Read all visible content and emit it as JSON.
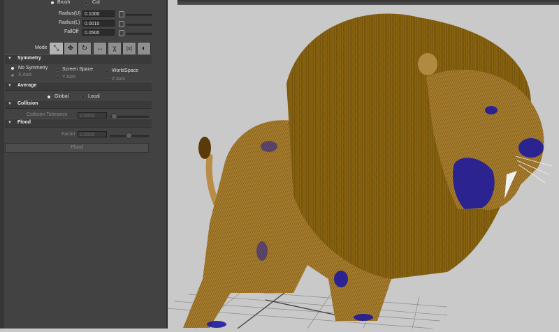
{
  "brush_options": {
    "brush": "Brush",
    "cut": "Cut"
  },
  "fields": [
    {
      "label": "Radius(U)",
      "value": "0.1000"
    },
    {
      "label": "Radius(L)",
      "value": "0.0010"
    },
    {
      "label": "FallOff",
      "value": "0.0500"
    }
  ],
  "mode": {
    "label": "Mode",
    "buttons": [
      {
        "icon": "comb-icon",
        "glyph": "⤡"
      },
      {
        "icon": "move-icon",
        "glyph": "✥"
      },
      {
        "icon": "rotate-icon",
        "glyph": "↻"
      },
      {
        "icon": "scale-icon",
        "glyph": "↔"
      },
      {
        "icon": "curl-icon",
        "glyph": "χ"
      },
      {
        "icon": "length-icon",
        "glyph": "|x|"
      },
      {
        "icon": "smooth-icon",
        "glyph": "◐"
      }
    ]
  },
  "symmetry": {
    "title": "Symmetry",
    "none": "No Symmetry",
    "screen": "Screen Space",
    "world": "WorldSpace",
    "x": "X Axis",
    "y": "Y Axis",
    "z": "Z Axis"
  },
  "average": {
    "title": "Average",
    "global": "Global",
    "local": "Local"
  },
  "collision": {
    "title": "Collision",
    "tolerance_label": "Collision Tolerance",
    "tolerance_value": "0.0000"
  },
  "flood": {
    "title": "Flood",
    "factor_label": "Factor",
    "factor_value": "0.0000",
    "button": "Flood"
  },
  "colors": {
    "panel": "#424242",
    "viewport": "#c9c9c9",
    "fur": "#8a6410",
    "selection": "#1f1a9e"
  }
}
